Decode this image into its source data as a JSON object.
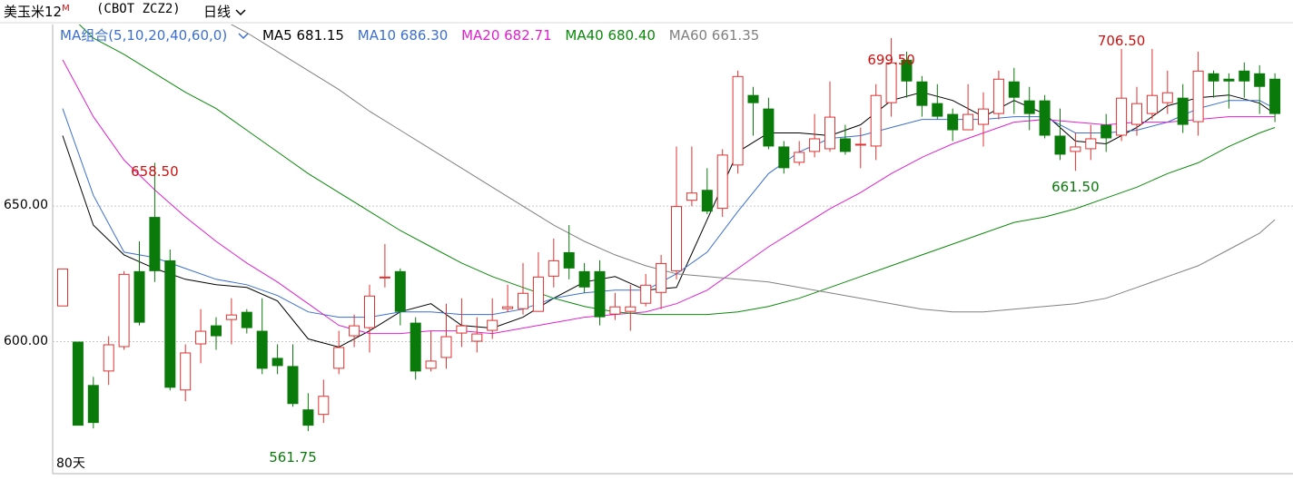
{
  "header": {
    "title": "美玉米12",
    "title_sup": "M",
    "code": "(CBOT ZCZ2)",
    "period": "日线",
    "period_icon": "chevron-down-icon"
  },
  "legend": {
    "combo_label": "MA组合(5,10,20,40,60,0)",
    "combo_icon": "chevron-down-icon",
    "items": [
      {
        "label": "MA5 681.15",
        "color": "#000000"
      },
      {
        "label": "MA10 686.30",
        "color": "#3b6fd1"
      },
      {
        "label": "MA20 682.71",
        "color": "#e020d0"
      },
      {
        "label": "MA40 680.40",
        "color": "#0a8a0a"
      },
      {
        "label": "MA60 661.35",
        "color": "#808080"
      }
    ]
  },
  "footer": {
    "days_label": "80天"
  },
  "colors": {
    "up": "#e03030",
    "down": "#0a7a0a",
    "grid": "#c8c8c8",
    "axis": "#b0b0b0"
  },
  "chart_data": {
    "type": "candlestick",
    "title": "美玉米12M (CBOT ZCZ2) 日线",
    "ylim": [
      560,
      715
    ],
    "y_ticks": [
      {
        "value": 600,
        "label": "600.00"
      },
      {
        "value": 650,
        "label": "650.00"
      }
    ],
    "grid_values": [
      600,
      650
    ],
    "candles": [
      [
        613,
        627,
        626,
        617
      ],
      [
        600,
        569,
        600,
        573
      ],
      [
        584,
        570,
        587,
        568
      ],
      [
        589,
        599,
        602,
        584
      ],
      [
        598,
        625,
        626,
        597
      ],
      [
        626,
        607,
        637,
        606
      ],
      [
        646,
        626,
        666,
        622
      ],
      [
        630,
        583,
        634,
        582
      ],
      [
        582,
        596,
        599,
        578
      ],
      [
        599,
        604,
        612,
        592
      ],
      [
        606,
        602,
        609,
        597
      ],
      [
        608,
        610,
        616,
        599
      ],
      [
        611,
        605,
        612,
        603
      ],
      [
        604,
        590,
        616,
        588
      ],
      [
        594,
        591,
        599,
        588
      ],
      [
        591,
        577,
        599,
        576
      ],
      [
        575,
        569,
        581,
        567
      ],
      [
        573,
        580,
        586,
        570
      ],
      [
        590,
        598,
        604,
        588
      ],
      [
        602,
        606,
        610,
        598
      ],
      [
        605,
        617,
        621,
        596
      ],
      [
        624,
        624,
        636,
        620
      ],
      [
        626,
        611,
        627,
        606
      ],
      [
        607,
        589,
        609,
        586
      ],
      [
        590,
        593,
        604,
        589
      ],
      [
        594,
        602,
        614,
        590
      ],
      [
        603,
        606,
        616,
        598
      ],
      [
        600,
        603,
        609,
        596
      ],
      [
        604,
        608,
        616,
        601
      ],
      [
        612,
        613,
        621,
        611
      ],
      [
        612,
        618,
        629,
        610
      ],
      [
        611,
        624,
        633,
        611
      ],
      [
        624,
        630,
        638,
        620
      ],
      [
        633,
        627,
        643,
        623
      ],
      [
        626,
        620,
        629,
        618
      ],
      [
        626,
        609,
        630,
        606
      ],
      [
        610,
        613,
        618,
        608
      ],
      [
        611,
        613,
        621,
        604
      ],
      [
        614,
        621,
        625,
        613
      ],
      [
        618,
        629,
        632,
        612
      ],
      [
        626,
        650,
        672,
        623
      ],
      [
        652,
        655,
        672,
        650
      ],
      [
        656,
        648,
        664,
        647
      ],
      [
        649,
        669,
        671,
        646
      ],
      [
        665,
        698,
        700,
        662
      ],
      [
        691,
        688,
        694,
        676
      ],
      [
        686,
        672,
        690,
        671
      ],
      [
        672,
        664,
        674,
        662
      ],
      [
        666,
        670,
        674,
        665
      ],
      [
        670,
        675,
        684,
        668
      ],
      [
        671,
        683,
        696,
        670
      ],
      [
        675,
        670,
        680,
        669
      ],
      [
        673,
        673,
        679,
        664
      ],
      [
        672,
        691,
        695,
        667
      ],
      [
        688,
        703,
        712,
        683
      ],
      [
        704,
        696,
        707,
        690
      ],
      [
        696,
        687,
        698,
        683
      ],
      [
        688,
        683,
        695,
        682
      ],
      [
        684,
        678,
        686,
        674
      ],
      [
        678,
        684,
        695,
        680
      ],
      [
        680,
        686,
        692,
        672
      ],
      [
        684,
        697,
        700,
        682
      ],
      [
        696,
        690,
        701,
        684
      ],
      [
        689,
        684,
        694,
        678
      ],
      [
        689,
        676,
        691,
        675
      ],
      [
        676,
        669,
        686,
        667
      ],
      [
        670,
        672,
        677,
        663
      ],
      [
        671,
        675,
        680,
        667
      ],
      [
        680,
        675,
        684,
        670
      ],
      [
        676,
        690,
        708,
        674
      ],
      [
        680,
        688,
        694,
        676
      ],
      [
        684,
        691,
        708,
        682
      ],
      [
        688,
        692,
        700,
        684
      ],
      [
        690,
        680,
        695,
        677
      ],
      [
        681,
        700,
        707,
        676
      ],
      [
        699,
        696,
        700,
        690
      ],
      [
        697,
        696,
        699,
        686
      ],
      [
        700,
        696,
        703,
        690
      ],
      [
        699,
        694,
        702,
        684
      ],
      [
        697,
        684,
        699,
        681
      ]
    ],
    "series": [
      {
        "name": "MA5",
        "color": "#000000",
        "values": [
          [
            0,
            676
          ],
          [
            2,
            643
          ],
          [
            4,
            632
          ],
          [
            6,
            627
          ],
          [
            8,
            623
          ],
          [
            10,
            621
          ],
          [
            12,
            620
          ],
          [
            14,
            615
          ],
          [
            16,
            601
          ],
          [
            18,
            598
          ],
          [
            20,
            604
          ],
          [
            22,
            611
          ],
          [
            24,
            614
          ],
          [
            26,
            606
          ],
          [
            28,
            605
          ],
          [
            30,
            609
          ],
          [
            32,
            616
          ],
          [
            34,
            622
          ],
          [
            36,
            624
          ],
          [
            38,
            619
          ],
          [
            40,
            620
          ],
          [
            42,
            645
          ],
          [
            44,
            670
          ],
          [
            46,
            677
          ],
          [
            48,
            677
          ],
          [
            50,
            676
          ],
          [
            52,
            680
          ],
          [
            54,
            689
          ],
          [
            56,
            692
          ],
          [
            58,
            689
          ],
          [
            60,
            683
          ],
          [
            62,
            689
          ],
          [
            64,
            684
          ],
          [
            66,
            674
          ],
          [
            68,
            673
          ],
          [
            70,
            679
          ],
          [
            72,
            687
          ],
          [
            74,
            690
          ],
          [
            76,
            691
          ],
          [
            78,
            688
          ],
          [
            79,
            684
          ]
        ]
      },
      {
        "name": "MA10",
        "color": "#3b6fd1",
        "values": [
          [
            0,
            686
          ],
          [
            2,
            654
          ],
          [
            4,
            633
          ],
          [
            6,
            631
          ],
          [
            8,
            627
          ],
          [
            10,
            623
          ],
          [
            12,
            621
          ],
          [
            14,
            617
          ],
          [
            16,
            611
          ],
          [
            18,
            609
          ],
          [
            20,
            609
          ],
          [
            22,
            611
          ],
          [
            24,
            611
          ],
          [
            26,
            610
          ],
          [
            28,
            610
          ],
          [
            30,
            612
          ],
          [
            32,
            616
          ],
          [
            34,
            618
          ],
          [
            36,
            619
          ],
          [
            38,
            619
          ],
          [
            40,
            625
          ],
          [
            42,
            633
          ],
          [
            44,
            648
          ],
          [
            46,
            662
          ],
          [
            48,
            670
          ],
          [
            50,
            675
          ],
          [
            52,
            676
          ],
          [
            54,
            679
          ],
          [
            56,
            682
          ],
          [
            58,
            682
          ],
          [
            60,
            682
          ],
          [
            62,
            683
          ],
          [
            64,
            683
          ],
          [
            66,
            677
          ],
          [
            68,
            677
          ],
          [
            70,
            678
          ],
          [
            72,
            681
          ],
          [
            74,
            686
          ],
          [
            76,
            689
          ],
          [
            78,
            689
          ],
          [
            79,
            686
          ]
        ]
      },
      {
        "name": "MA20",
        "color": "#e020d0",
        "values": [
          [
            0,
            704
          ],
          [
            2,
            683
          ],
          [
            4,
            667
          ],
          [
            6,
            656
          ],
          [
            8,
            646
          ],
          [
            10,
            637
          ],
          [
            12,
            629
          ],
          [
            14,
            622
          ],
          [
            16,
            614
          ],
          [
            18,
            606
          ],
          [
            20,
            603
          ],
          [
            22,
            603
          ],
          [
            24,
            604
          ],
          [
            26,
            604
          ],
          [
            28,
            603
          ],
          [
            30,
            605
          ],
          [
            32,
            607
          ],
          [
            34,
            609
          ],
          [
            36,
            610
          ],
          [
            38,
            611
          ],
          [
            40,
            614
          ],
          [
            42,
            619
          ],
          [
            44,
            627
          ],
          [
            46,
            635
          ],
          [
            48,
            642
          ],
          [
            50,
            649
          ],
          [
            52,
            655
          ],
          [
            54,
            662
          ],
          [
            56,
            668
          ],
          [
            58,
            673
          ],
          [
            60,
            677
          ],
          [
            62,
            681
          ],
          [
            64,
            682
          ],
          [
            66,
            681
          ],
          [
            68,
            680
          ],
          [
            70,
            681
          ],
          [
            72,
            681
          ],
          [
            74,
            682
          ],
          [
            76,
            683
          ],
          [
            78,
            683
          ],
          [
            79,
            683
          ]
        ]
      },
      {
        "name": "MA40",
        "color": "#0a8a0a",
        "values": [
          [
            0,
            723
          ],
          [
            2,
            712
          ],
          [
            4,
            706
          ],
          [
            6,
            699
          ],
          [
            8,
            692
          ],
          [
            10,
            686
          ],
          [
            12,
            678
          ],
          [
            14,
            670
          ],
          [
            16,
            662
          ],
          [
            18,
            655
          ],
          [
            20,
            648
          ],
          [
            22,
            641
          ],
          [
            24,
            635
          ],
          [
            26,
            629
          ],
          [
            28,
            624
          ],
          [
            30,
            620
          ],
          [
            32,
            616
          ],
          [
            34,
            613
          ],
          [
            36,
            611
          ],
          [
            38,
            610
          ],
          [
            40,
            610
          ],
          [
            42,
            610
          ],
          [
            44,
            611
          ],
          [
            46,
            613
          ],
          [
            48,
            616
          ],
          [
            50,
            620
          ],
          [
            52,
            624
          ],
          [
            54,
            628
          ],
          [
            56,
            632
          ],
          [
            58,
            636
          ],
          [
            60,
            640
          ],
          [
            62,
            644
          ],
          [
            64,
            646
          ],
          [
            66,
            649
          ],
          [
            68,
            653
          ],
          [
            70,
            657
          ],
          [
            72,
            662
          ],
          [
            74,
            666
          ],
          [
            76,
            672
          ],
          [
            78,
            677
          ],
          [
            79,
            679
          ]
        ]
      },
      {
        "name": "MA60",
        "color": "#808080",
        "values": [
          [
            0,
            741
          ],
          [
            2,
            737
          ],
          [
            4,
            734
          ],
          [
            6,
            729
          ],
          [
            8,
            726
          ],
          [
            10,
            720
          ],
          [
            12,
            714
          ],
          [
            14,
            707
          ],
          [
            16,
            700
          ],
          [
            18,
            693
          ],
          [
            20,
            685
          ],
          [
            22,
            678
          ],
          [
            24,
            671
          ],
          [
            26,
            664
          ],
          [
            28,
            657
          ],
          [
            30,
            650
          ],
          [
            32,
            643
          ],
          [
            34,
            637
          ],
          [
            36,
            632
          ],
          [
            38,
            628
          ],
          [
            40,
            625
          ],
          [
            42,
            624
          ],
          [
            44,
            623
          ],
          [
            46,
            622
          ],
          [
            48,
            620
          ],
          [
            50,
            618
          ],
          [
            52,
            616
          ],
          [
            54,
            614
          ],
          [
            56,
            612
          ],
          [
            58,
            611
          ],
          [
            60,
            611
          ],
          [
            62,
            612
          ],
          [
            64,
            613
          ],
          [
            66,
            614
          ],
          [
            68,
            616
          ],
          [
            70,
            620
          ],
          [
            72,
            624
          ],
          [
            74,
            628
          ],
          [
            76,
            634
          ],
          [
            78,
            640
          ],
          [
            79,
            645
          ]
        ]
      }
    ],
    "annotations": [
      {
        "index": 6,
        "value": 658.5,
        "label": "658.50",
        "type": "high",
        "color": "#d01010"
      },
      {
        "index": 15,
        "value": 561.75,
        "label": "561.75",
        "type": "low",
        "color": "#0a7a0a"
      },
      {
        "index": 54,
        "value": 699.5,
        "label": "699.50",
        "type": "high",
        "color": "#d01010"
      },
      {
        "index": 66,
        "value": 661.5,
        "label": "661.50",
        "type": "low",
        "color": "#0a7a0a"
      },
      {
        "index": 69,
        "value": 706.5,
        "label": "706.50",
        "type": "high",
        "color": "#d01010"
      }
    ]
  }
}
